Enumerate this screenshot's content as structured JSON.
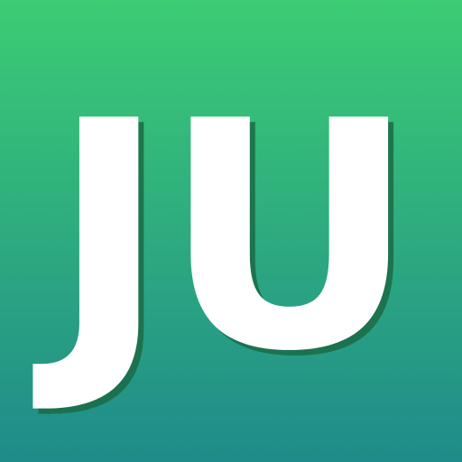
{
  "avatar": {
    "initials": "JU",
    "colors": {
      "gradient_top": "#3ccc74",
      "gradient_bottom": "#1f8b8a",
      "text": "#ffffff",
      "shadow": "#1a6b45"
    }
  }
}
